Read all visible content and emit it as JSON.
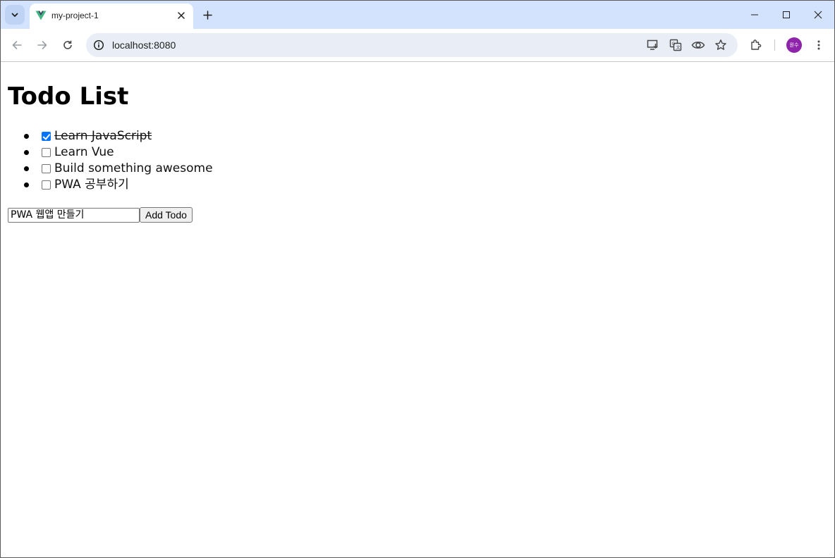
{
  "browser": {
    "tab": {
      "title": "my-project-1",
      "favicon": "vue-logo-icon"
    },
    "address": {
      "url": "localhost:8080"
    },
    "profile": {
      "initials": "원수",
      "color": "#8e24aa"
    },
    "colors": {
      "tabstrip": "#d3e3fd",
      "omnibox": "#e9eef6"
    }
  },
  "page": {
    "title": "Todo List",
    "todos": [
      {
        "text": "Learn JavaScript",
        "done": true
      },
      {
        "text": "Learn Vue",
        "done": false
      },
      {
        "text": "Build something awesome",
        "done": false
      },
      {
        "text": "PWA 공부하기",
        "done": false
      }
    ],
    "new_todo": {
      "value": "PWA 웹앱 만들기"
    },
    "add_button": {
      "label": "Add Todo"
    }
  }
}
